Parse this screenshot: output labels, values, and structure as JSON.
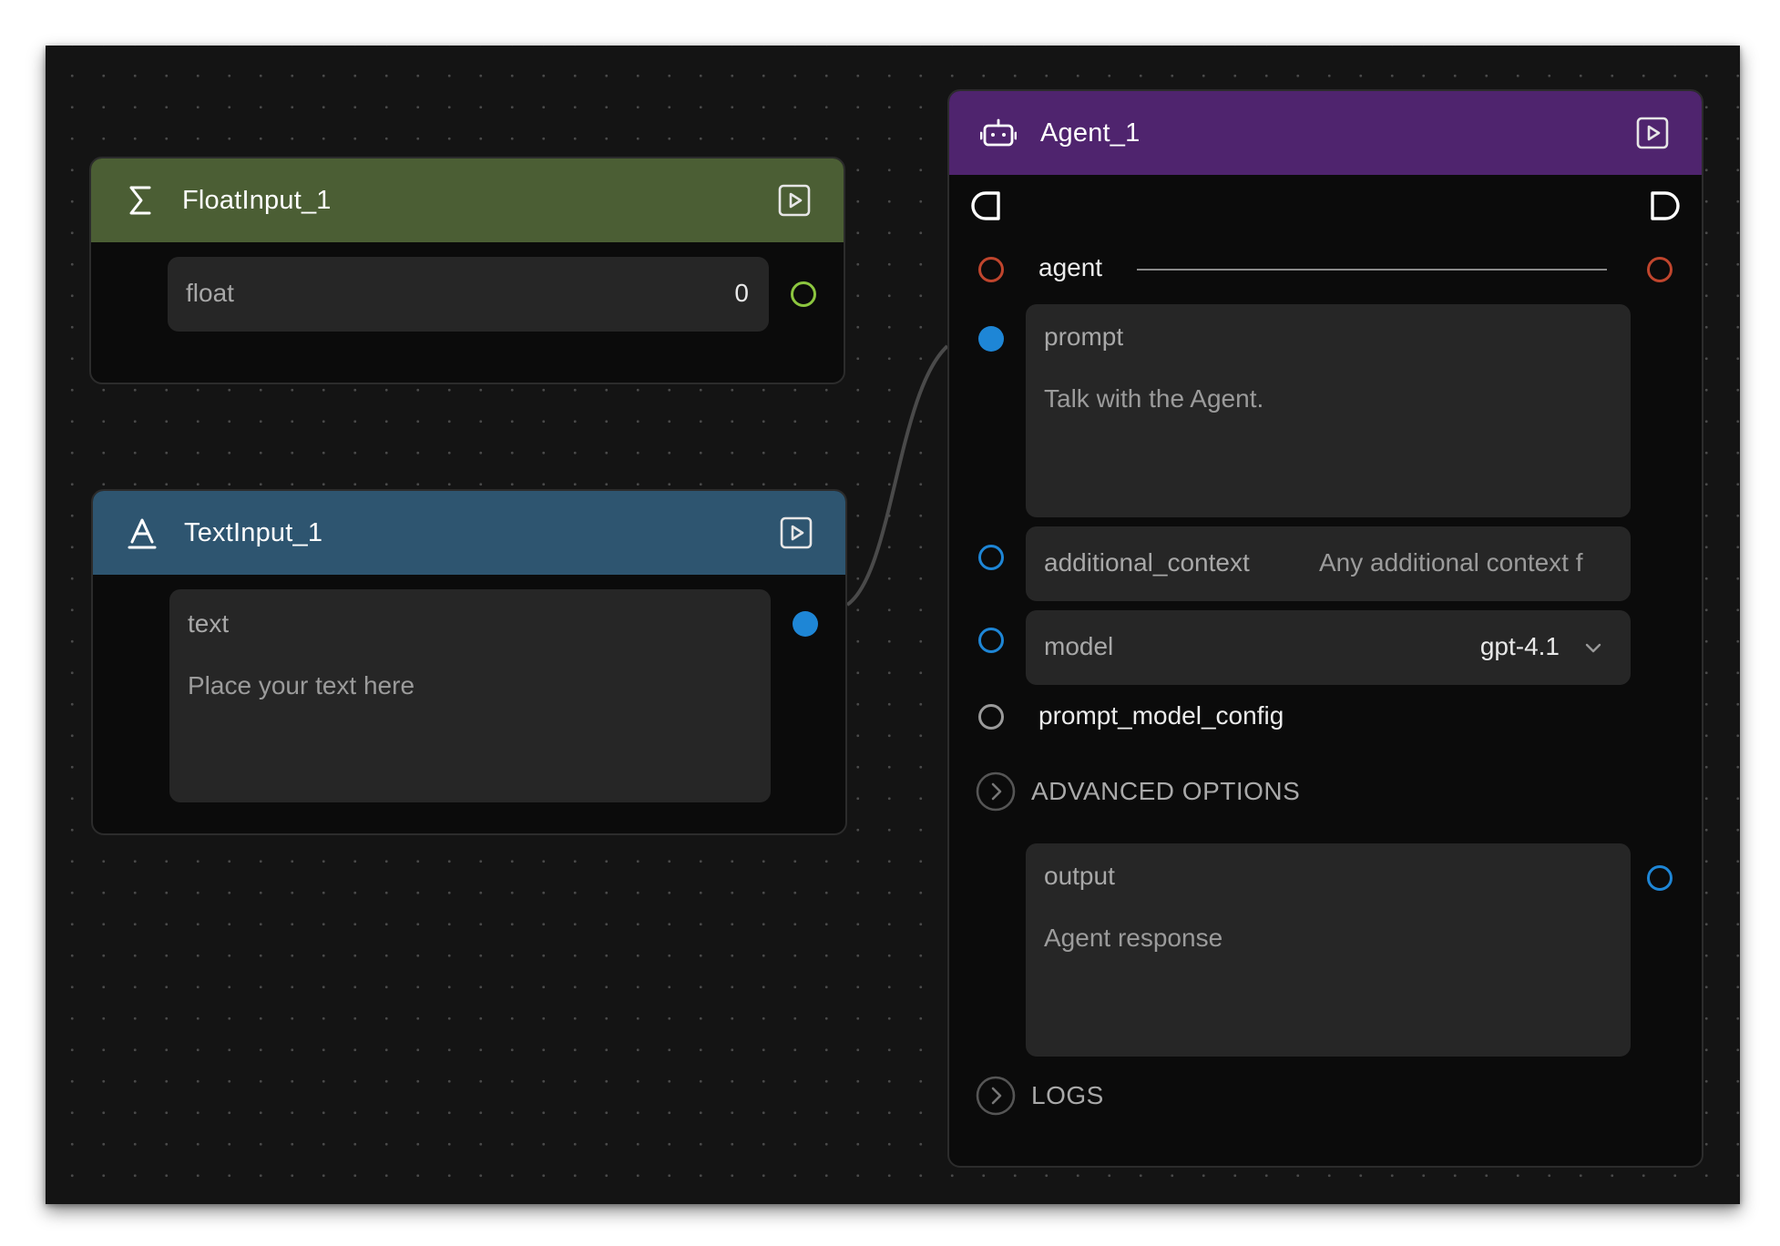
{
  "colors": {
    "canvas_bg": "#141414",
    "float_header": "#4b5e34",
    "text_header": "#2e5570",
    "agent_header": "#4f246e",
    "handle_blue": "#1e86d6",
    "handle_green": "#8cc63f",
    "handle_red": "#c0452d",
    "handle_gray": "#9a9a9a"
  },
  "float_node": {
    "icon": "sigma-icon",
    "title": "FloatInput_1",
    "field_label": "float",
    "field_value": "0"
  },
  "text_node": {
    "icon": "text-a-icon",
    "title": "TextInput_1",
    "field_label": "text",
    "field_placeholder": "Place your text here"
  },
  "agent_node": {
    "icon": "robot-icon",
    "title": "Agent_1",
    "agent_label": "agent",
    "prompt_label": "prompt",
    "prompt_placeholder": "Talk with the Agent.",
    "additional_context_label": "additional_context",
    "additional_context_placeholder": "Any additional context f",
    "model_label": "model",
    "model_value": "gpt-4.1",
    "prompt_model_config_label": "prompt_model_config",
    "advanced_options_label": "ADVANCED OPTIONS",
    "output_label": "output",
    "output_placeholder": "Agent response",
    "logs_label": "LOGS"
  }
}
